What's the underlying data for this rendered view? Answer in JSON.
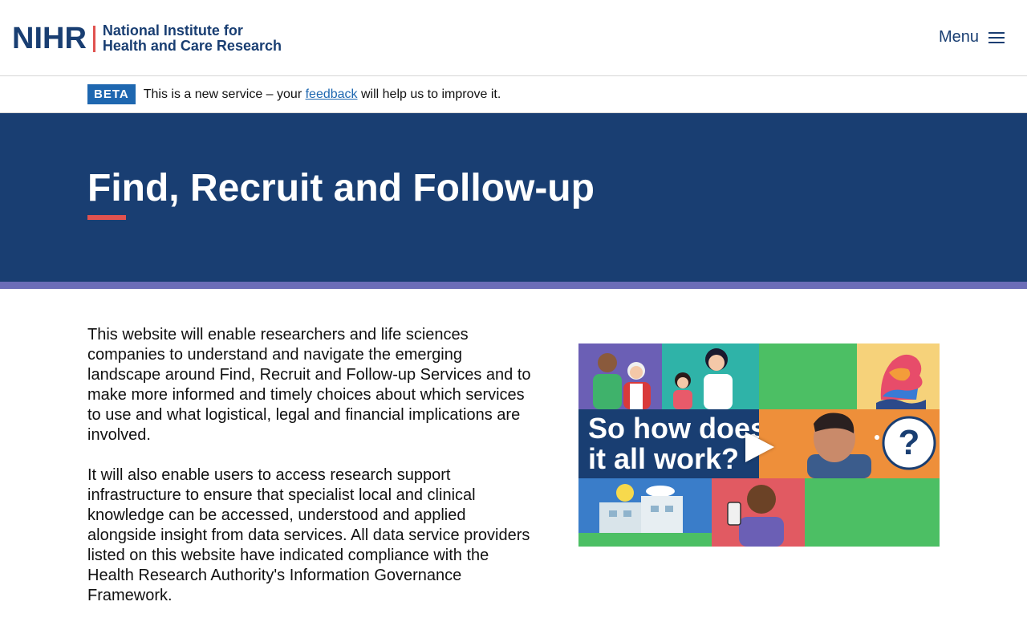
{
  "header": {
    "logo_mark": "NIHR",
    "logo_line1": "National Institute for",
    "logo_line2": "Health and Care Research",
    "menu_label": "Menu"
  },
  "beta": {
    "tag": "BETA",
    "text_before": "This is a new service – your ",
    "link": "feedback",
    "text_after": " will help us to improve it."
  },
  "hero": {
    "title": "Find, Recruit and Follow-up"
  },
  "main": {
    "paragraphs": [
      "This website will enable researchers and life sciences companies to understand and navigate the emerging landscape around Find, Recruit and Follow-up Services and to make more informed and timely choices about which services to use and what logistical, legal and financial implications are involved.",
      "It will also enable users to access research support infrastructure to ensure that specialist local and clinical knowledge can be accessed, understood and applied alongside insight from data services. All data service providers listed on this website have indicated compliance with the Health Research Authority's Information Governance Framework."
    ]
  },
  "video": {
    "title_line1": "So how does",
    "title_line2": "it all work?",
    "question_mark": "?",
    "icon": "play-icon"
  },
  "colors": {
    "navy": "#193e72",
    "accent_red": "#e0524f",
    "beta_blue": "#1e67b0",
    "stripe_purple": "#6b6db8"
  }
}
